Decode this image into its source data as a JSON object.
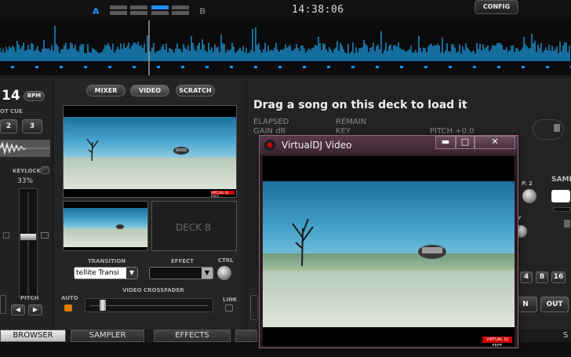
{
  "topbar": {
    "deck_a_letter": "A",
    "deck_b_letter": "B",
    "clock": "14:38:06",
    "config_label": "CONFIG",
    "accent": "#1e90ff"
  },
  "left_deck": {
    "bpm_value": "14",
    "bpm_badge": "BPM",
    "hotcue_label": "OT CUE",
    "hotcue_buttons": [
      "2",
      "3"
    ],
    "keylock_label": "KEYLOCK",
    "keylock_value": "33%",
    "pitch_label": "PITCH",
    "pitch_left": "◀",
    "pitch_right": "▶"
  },
  "mixer": {
    "tabs": [
      "MIXER",
      "VIDEO",
      "SCRATCH"
    ],
    "deck_b_label": "DECK B",
    "transition_label": "TRANSITION",
    "transition_value": "tellite Transi",
    "effect_label": "EFFECT",
    "effect_value": "",
    "ctrl_label": "CTRL",
    "crossfader_label": "VIDEO CROSSFADER",
    "auto_label": "AUTO",
    "link_label": "LINK",
    "logo_text": "VIRTUAL DJ FREE"
  },
  "right_deck": {
    "load_prompt": "Drag a song on this deck to load it",
    "elapsed_label": "ELAPSED",
    "remain_label": "REMAIN",
    "gain_label": "GAIN dB",
    "key_label": "KEY",
    "pitch_label": "PITCH +0.0",
    "p2_label": "P. 2",
    "samp_label": "SAMP",
    "ey_label": "EY",
    "loop_buttons": [
      "4",
      "8",
      "16"
    ],
    "in_label": "N",
    "out_label": "OUT",
    "s_label": "S"
  },
  "bottom_tabs": {
    "browser": "BROWSER",
    "sampler": "SAMPLER",
    "effects": "EFFECTS"
  },
  "video_window": {
    "title": "VirtualDJ Video",
    "minimize": "▬",
    "maximize": "□",
    "close": "✕",
    "logo_text": "VIRTUAL DJ FREE"
  }
}
